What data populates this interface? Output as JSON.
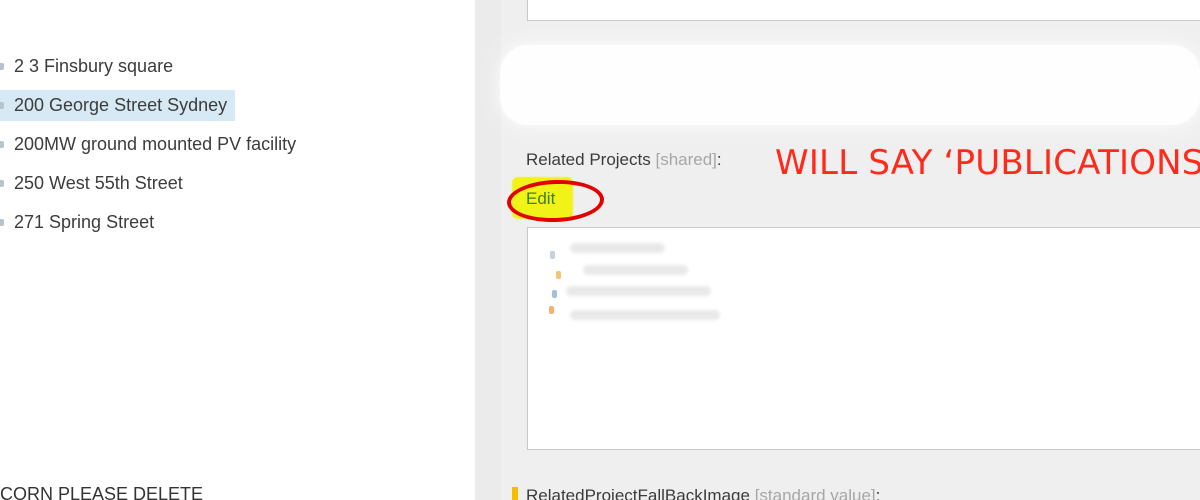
{
  "tree": {
    "items": [
      {
        "label": "2 3 Finsbury square",
        "selected": false
      },
      {
        "label": "200 George Street Sydney",
        "selected": true
      },
      {
        "label": "200MW ground mounted PV facility",
        "selected": false
      },
      {
        "label": "250 West 55th Street",
        "selected": false
      },
      {
        "label": "271 Spring Street",
        "selected": false
      }
    ],
    "bottom_partial_label": "CORN PLEASE DELETE"
  },
  "fields": {
    "related_projects": {
      "label": "Related Projects",
      "scope": "[shared]",
      "colon": ":",
      "edit_label": "Edit"
    },
    "related_project_fallback_image": {
      "label": "RelatedProjectFallBackImage",
      "scope": "[standard value]",
      "colon": ":"
    }
  },
  "annotation": {
    "text": "WILL SAY ‘PUBLICATIONS’",
    "color": "#ff2a1a"
  },
  "colors": {
    "selected_row": "#d6e9f4",
    "edit_highlight": "#f1f218",
    "circle": "#e30000",
    "accent_bar": "#f3be00",
    "edit_link": "#3e7f2e"
  }
}
